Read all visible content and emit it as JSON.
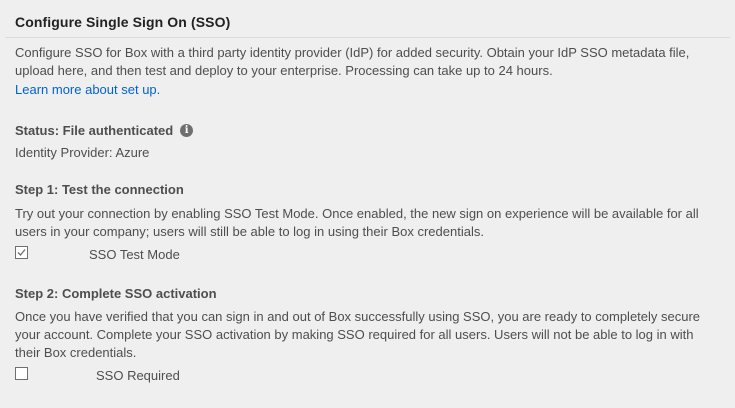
{
  "header": {
    "title": "Configure Single Sign On (SSO)"
  },
  "intro": {
    "text": "Configure SSO for Box with a third party identity provider (IdP) for added security. Obtain your IdP SSO metadata file, upload here, and then test and deploy to your enterprise. Processing can take up to 24 hours.",
    "link": "Learn more about set up."
  },
  "status": {
    "label": "Status: File authenticated",
    "info_icon": "i",
    "identity_provider": "Identity Provider: Azure"
  },
  "step1": {
    "heading": "Step 1: Test the connection",
    "text": "Try out your connection by enabling SSO Test Mode. Once enabled, the new sign on experience will be available for all users in your company; users will still be able to log in using their Box credentials.",
    "checkbox_label": "SSO Test Mode",
    "checked": true
  },
  "step2": {
    "heading": "Step 2: Complete SSO activation",
    "text": "Once you have verified that you can sign in and out of Box successfully using SSO, you are ready to completely secure your account. Complete your SSO activation by making SSO required for all users. Users will not be able to log in with their Box credentials.",
    "checkbox_label": "SSO Required",
    "checked": false
  },
  "colors": {
    "link": "#0061d5",
    "text": "#4e4e4e",
    "background": "#efefef"
  }
}
